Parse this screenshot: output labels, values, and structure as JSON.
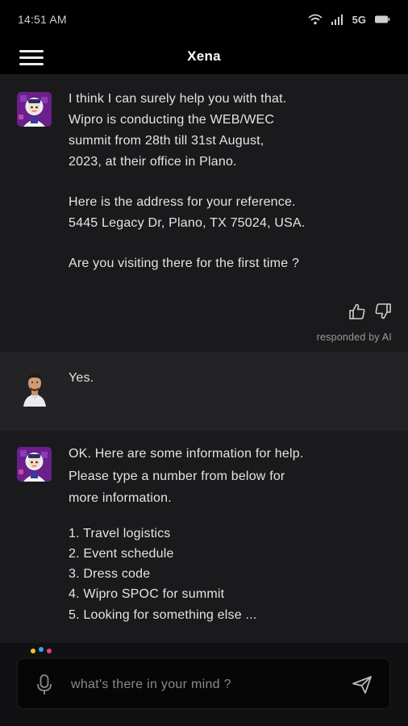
{
  "status_bar": {
    "time": "14:51 AM",
    "network": "5G"
  },
  "header": {
    "title": "Xena"
  },
  "messages": [
    {
      "sender": "bot",
      "paragraphs": [
        [
          "I think I can surely help you with that.",
          "Wipro is conducting the WEB/WEC",
          "summit from 28th till 31st August,",
          "2023, at their office in Plano."
        ],
        [
          "Here is the address for your reference.",
          "5445 Legacy Dr, Plano, TX 75024, USA."
        ],
        [
          "Are you visiting there for the first time ?"
        ]
      ],
      "footer": "responded by AI"
    },
    {
      "sender": "user",
      "text": "Yes."
    },
    {
      "sender": "bot",
      "intro": [
        "OK. Here are some information for help.",
        "Please type a number from below for",
        "more information."
      ],
      "options": [
        "1. Travel logistics",
        "2. Event schedule",
        "3. Dress code",
        "4. Wipro SPOC for summit",
        "5. Looking for something else ..."
      ]
    }
  ],
  "composer": {
    "placeholder": "what's there in your mind ?",
    "value": ""
  },
  "colors": {
    "bot_bg": "#1a1a1c",
    "user_bg": "#232326",
    "dot_1": "#f2c12e",
    "dot_2": "#3aa4e8",
    "dot_3": "#e93c8f"
  },
  "icons": [
    "menu-icon",
    "wifi-icon",
    "signal-icon",
    "battery-icon",
    "thumbs-up-icon",
    "thumbs-down-icon",
    "mic-icon",
    "send-icon"
  ]
}
